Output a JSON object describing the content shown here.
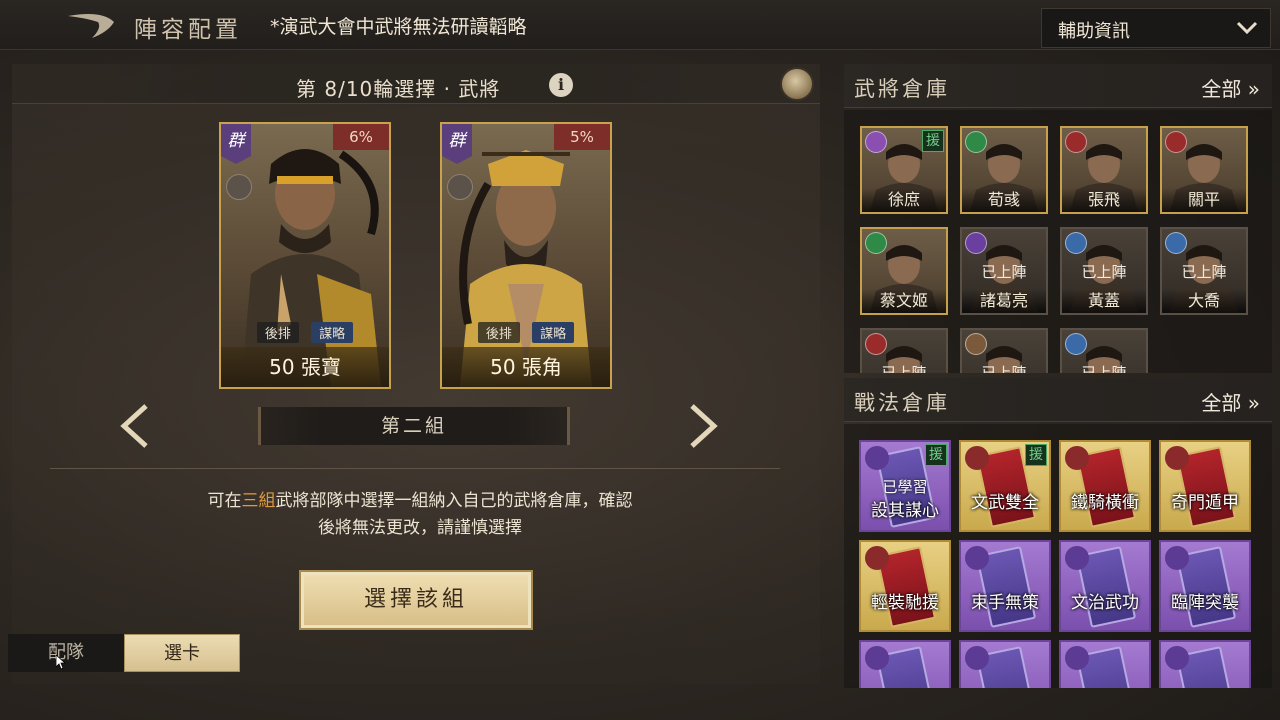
{
  "header": {
    "title": "陣容配置",
    "notice": "*演武大會中武將無法研讀韜略",
    "assist_select": "輔助資訊"
  },
  "round": {
    "text": "第 8/10輪選擇 · 武將",
    "info": "i"
  },
  "cards": [
    {
      "faction": "群",
      "percent": "6%",
      "tags": [
        "後排",
        "謀略"
      ],
      "name": "50 張寶"
    },
    {
      "faction": "群",
      "percent": "5%",
      "tags": [
        "後排",
        "謀略"
      ],
      "name": "50 張角"
    }
  ],
  "group": {
    "label": "第二組"
  },
  "description": {
    "part1": "可在",
    "highlight": "三組",
    "part2": "武將部隊中選擇一組納入自己的武將倉庫，確認",
    "line2": "後將無法更改，請謹慎選擇"
  },
  "choose_button": "選擇該組",
  "bottom_tabs": {
    "team": "配隊",
    "cards": "選卡"
  },
  "general_storage": {
    "title": "武將倉庫",
    "filter": "全部 »",
    "items": [
      {
        "name": "徐庶",
        "status": "",
        "help": "援",
        "badge_color": "#8a4fb0"
      },
      {
        "name": "荀彧",
        "status": "",
        "help": "",
        "badge_color": "#2f8a47"
      },
      {
        "name": "張飛",
        "status": "",
        "help": "",
        "badge_color": "#9a2b2b"
      },
      {
        "name": "關平",
        "status": "",
        "help": "",
        "badge_color": "#9a2b2b"
      },
      {
        "name": "蔡文姬",
        "status": "",
        "help": "",
        "badge_color": "#2f8a47"
      },
      {
        "name": "諸葛亮",
        "status": "已上陣",
        "help": "",
        "badge_color": "#6a3fa0"
      },
      {
        "name": "黃蓋",
        "status": "已上陣",
        "help": "",
        "badge_color": "#3b6aa8"
      },
      {
        "name": "大喬",
        "status": "已上陣",
        "help": "",
        "badge_color": "#3b6aa8"
      },
      {
        "name": "",
        "status": "已上陣",
        "help": "",
        "badge_color": "#9a2b2b"
      },
      {
        "name": "",
        "status": "已上陣",
        "help": "",
        "badge_color": "#7a5a3a"
      },
      {
        "name": "",
        "status": "已上陣",
        "help": "",
        "badge_color": "#3b6aa8"
      }
    ]
  },
  "skill_storage": {
    "title": "戰法倉庫",
    "filter": "全部 »",
    "items": [
      {
        "name": "設其謀心",
        "learned": "已學習",
        "help": "援",
        "style": "purple"
      },
      {
        "name": "文武雙全",
        "learned": "",
        "help": "援",
        "style": "gold"
      },
      {
        "name": "鐵騎橫衝",
        "learned": "",
        "help": "",
        "style": "gold"
      },
      {
        "name": "奇門遁甲",
        "learned": "",
        "help": "",
        "style": "gold"
      },
      {
        "name": "輕裝馳援",
        "learned": "",
        "help": "",
        "style": "gold"
      },
      {
        "name": "束手無策",
        "learned": "",
        "help": "",
        "style": "purple"
      },
      {
        "name": "文治武功",
        "learned": "",
        "help": "",
        "style": "purple"
      },
      {
        "name": "臨陣突襲",
        "learned": "",
        "help": "",
        "style": "purple"
      },
      {
        "name": "",
        "learned": "",
        "help": "",
        "style": "purple"
      },
      {
        "name": "",
        "learned": "",
        "help": "",
        "style": "purple"
      },
      {
        "name": "",
        "learned": "",
        "help": "",
        "style": "purple"
      },
      {
        "name": "",
        "learned": "",
        "help": "",
        "style": "purple"
      }
    ]
  }
}
